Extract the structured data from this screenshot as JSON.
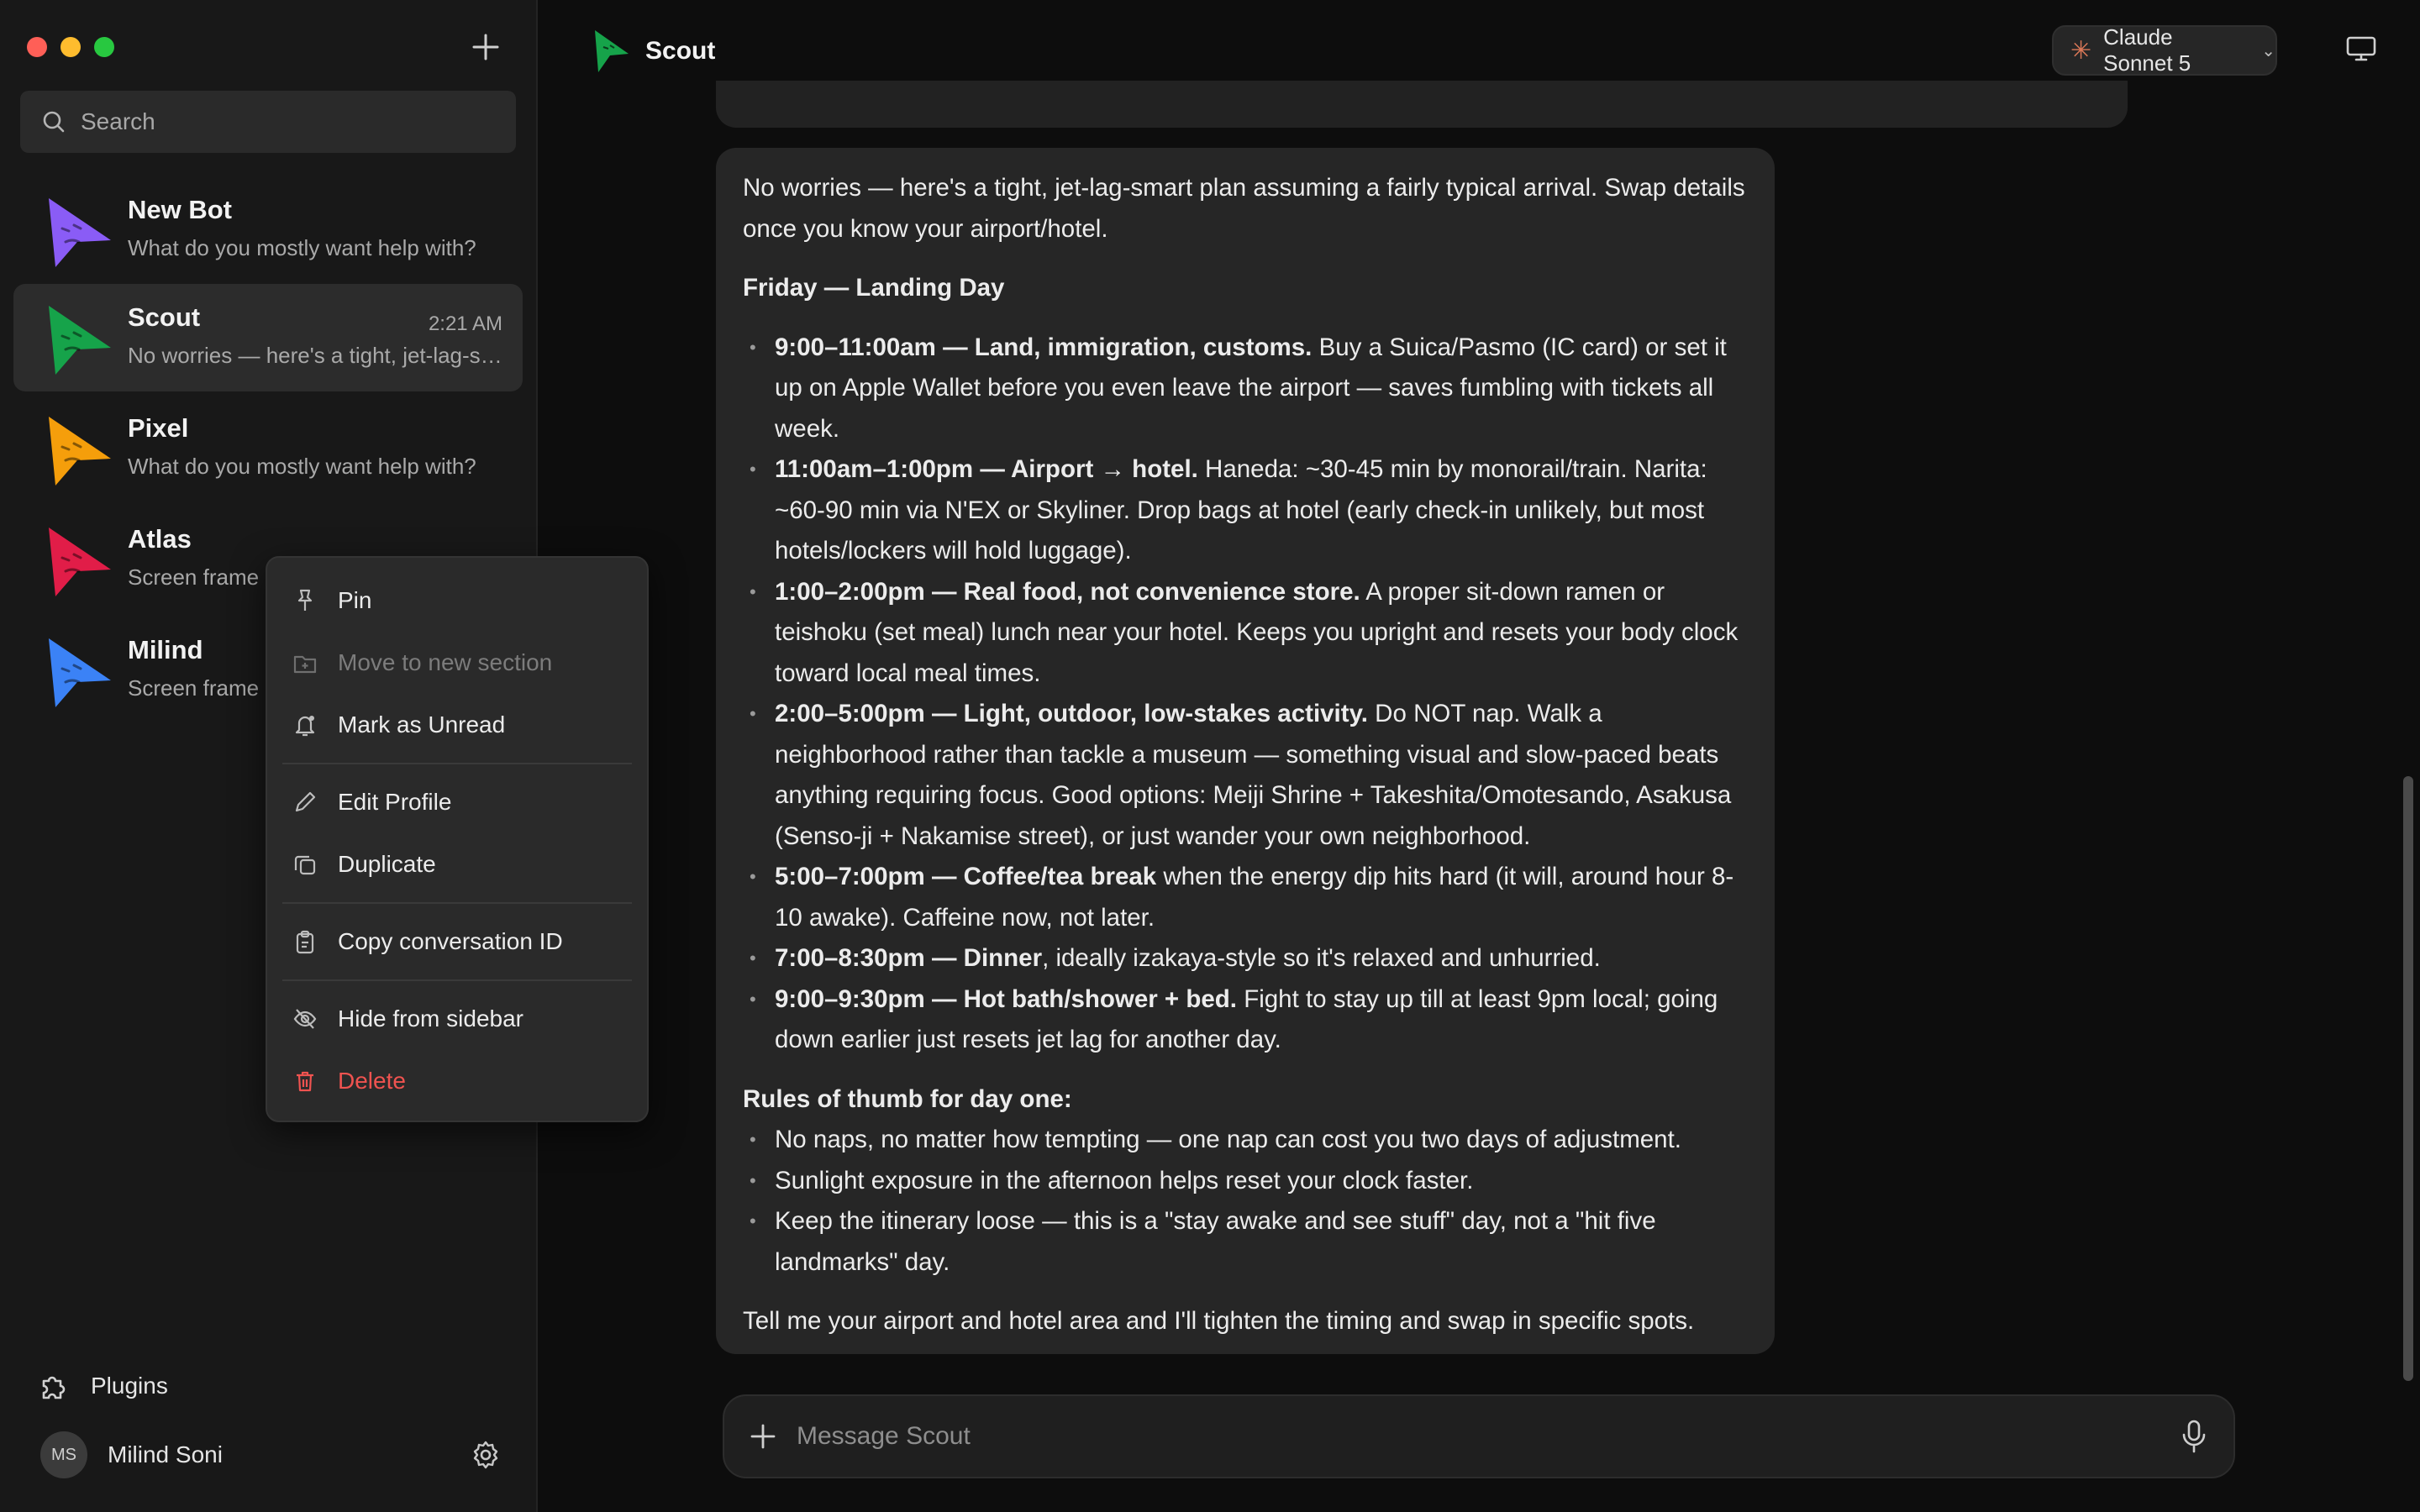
{
  "window": {
    "traffic_colors": [
      "#ff5f57",
      "#febc2e",
      "#28c840"
    ]
  },
  "sidebar": {
    "search_placeholder": "Search",
    "conversations": [
      {
        "name": "New Bot",
        "preview": "What do you mostly want help with?",
        "time": "",
        "color": "#8a5cf6"
      },
      {
        "name": "Scout",
        "preview": "No worries — here's a tight, jet-lag-smart plan assuming a fairly typical arrival.",
        "time": "2:21 AM",
        "color": "#16a34a"
      },
      {
        "name": "Pixel",
        "preview": "What do you mostly want help with?",
        "time": "",
        "color": "#f59e0b"
      },
      {
        "name": "Atlas",
        "preview": "Screen frame",
        "time": "",
        "color": "#e11d48"
      },
      {
        "name": "Milind",
        "preview": "Screen frame",
        "time": "",
        "color": "#3b82f6"
      }
    ],
    "plugins_label": "Plugins",
    "user": {
      "initials": "MS",
      "name": "Milind Soni"
    }
  },
  "header": {
    "title": "Scout",
    "model": "Claude Sonnet 5"
  },
  "context_menu": {
    "items": [
      {
        "label": "Pin",
        "icon": "pin-icon"
      },
      {
        "label": "Move to new section",
        "icon": "folder-plus-icon",
        "disabled": true
      },
      {
        "label": "Mark as Unread",
        "icon": "bell-icon"
      },
      {
        "label": "Edit Profile",
        "icon": "pencil-icon"
      },
      {
        "label": "Duplicate",
        "icon": "copy-icon"
      },
      {
        "label": "Copy conversation ID",
        "icon": "clipboard-icon"
      },
      {
        "label": "Hide from sidebar",
        "icon": "eye-off-icon"
      },
      {
        "label": "Delete",
        "icon": "trash-icon",
        "danger": true
      }
    ]
  },
  "message": {
    "intro": "No worries — here's a tight, jet-lag-smart plan assuming a fairly typical arrival. Swap details once you know your airport/hotel.",
    "heading": "Friday — Landing Day",
    "schedule": [
      {
        "bold": "9:00–11:00am — Land, immigration, customs.",
        "text": " Buy a Suica/Pasmo (IC card) or set it up on Apple Wallet before you even leave the airport — saves fumbling with tickets all week."
      },
      {
        "bold": "11:00am–1:00pm — Airport → hotel.",
        "text": " Haneda: ~30-45 min by monorail/train. Narita: ~60-90 min via N'EX or Skyliner. Drop bags at hotel (early check-in unlikely, but most hotels/lockers will hold luggage)."
      },
      {
        "bold": "1:00–2:00pm — Real food, not convenience store.",
        "text": " A proper sit-down ramen or teishoku (set meal) lunch near your hotel. Keeps you upright and resets your body clock toward local meal times."
      },
      {
        "bold": "2:00–5:00pm — Light, outdoor, low-stakes activity.",
        "text": " Do NOT nap. Walk a neighborhood rather than tackle a museum — something visual and slow-paced beats anything requiring focus. Good options: Meiji Shrine + Takeshita/Omotesando, Asakusa (Senso-ji + Nakamise street), or just wander your own neighborhood."
      },
      {
        "bold": "5:00–7:00pm — Coffee/tea break",
        "text": " when the energy dip hits hard (it will, around hour 8-10 awake). Caffeine now, not later."
      },
      {
        "bold": "7:00–8:30pm — Dinner",
        "text": ", ideally izakaya-style so it's relaxed and unhurried."
      },
      {
        "bold": "9:00–9:30pm — Hot bath/shower + bed.",
        "text": " Fight to stay up till at least 9pm local; going down earlier just resets jet lag for another day."
      }
    ],
    "rules_heading": "Rules of thumb for day one:",
    "rules": [
      "No naps, no matter how tempting — one nap can cost you two days of adjustment.",
      "Sunlight exposure in the afternoon helps reset your clock faster.",
      "Keep the itinerary loose — this is a \"stay awake and see stuff\" day, not a \"hit five landmarks\" day."
    ],
    "closing": "Tell me your airport and hotel area and I'll tighten the timing and swap in specific spots."
  },
  "composer": {
    "placeholder": "Message Scout"
  }
}
